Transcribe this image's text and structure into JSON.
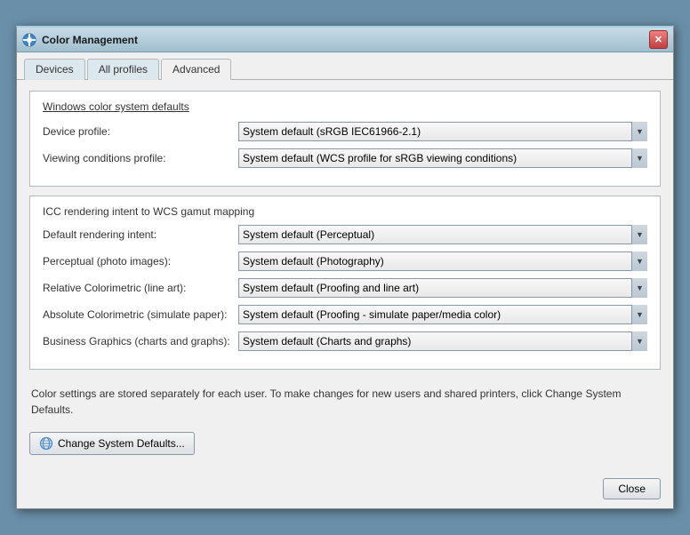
{
  "window": {
    "title": "Color Management",
    "icon": "🎨"
  },
  "tabs": [
    {
      "id": "devices",
      "label": "Devices",
      "active": false
    },
    {
      "id": "all-profiles",
      "label": "All profiles",
      "active": false
    },
    {
      "id": "advanced",
      "label": "Advanced",
      "active": true
    }
  ],
  "sections": {
    "windows_defaults": {
      "title": "Windows color system defaults",
      "device_profile_label": "Device profile:",
      "device_profile_value": "System default (sRGB IEC61966-2.1)",
      "viewing_conditions_label": "Viewing conditions profile:",
      "viewing_conditions_value": "System default (WCS profile for sRGB viewing conditions)"
    },
    "icc_rendering": {
      "title": "ICC  rendering intent to WCS gamut mapping",
      "rows": [
        {
          "label": "Default rendering intent:",
          "value": "System default (Perceptual)"
        },
        {
          "label": "Perceptual (photo images):",
          "value": "System default (Photography)"
        },
        {
          "label": "Relative Colorimetric (line art):",
          "value": "System default (Proofing and line art)"
        },
        {
          "label": "Absolute Colorimetric (simulate paper):",
          "value": "System default (Proofing - simulate paper/media color)"
        },
        {
          "label": "Business Graphics (charts and graphs):",
          "value": "System default (Charts and graphs)"
        }
      ]
    }
  },
  "info_text": "Color settings are stored separately for each user. To make changes for new users and shared printers, click Change System Defaults.",
  "change_defaults_button": "Change System Defaults...",
  "close_button": "Close"
}
